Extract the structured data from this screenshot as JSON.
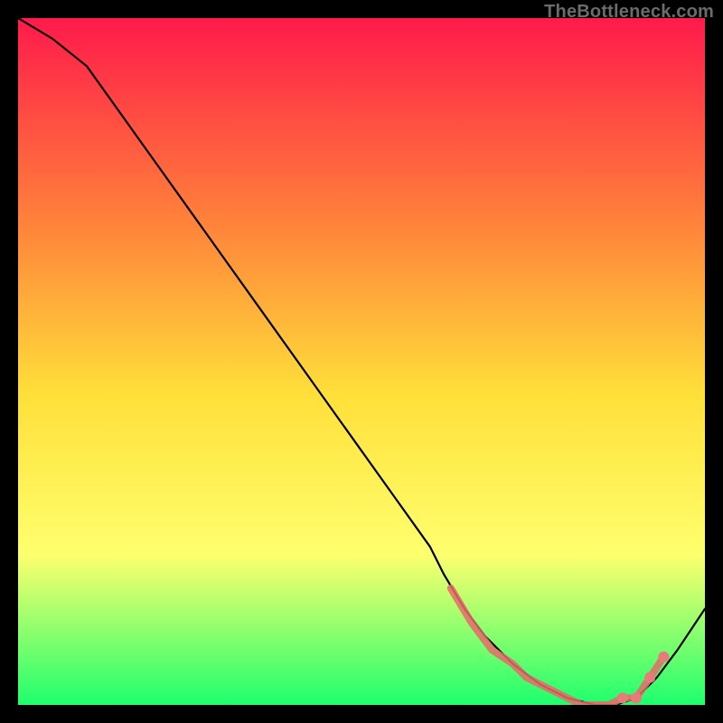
{
  "watermark": "TheBottleneck.com",
  "colors": {
    "gradient_top": "#ff1a4b",
    "gradient_mid1": "#ff833a",
    "gradient_mid2": "#ffe03a",
    "gradient_mid3": "#ffff6e",
    "gradient_bottom": "#1eff6e",
    "line": "#000000",
    "marker": "#e86a6a",
    "marker_fill": "#e97a7a"
  },
  "chart_data": {
    "type": "line",
    "title": "",
    "xlabel": "",
    "ylabel": "",
    "xlim": [
      0,
      100
    ],
    "ylim": [
      0,
      100
    ],
    "series": [
      {
        "name": "curve",
        "x": [
          0,
          5,
          10,
          15,
          20,
          25,
          30,
          35,
          40,
          45,
          50,
          55,
          60,
          62,
          65,
          68,
          72,
          76,
          80,
          84,
          87,
          90,
          93,
          96,
          100
        ],
        "y": [
          100,
          97,
          93,
          86,
          79,
          72,
          65,
          58,
          51,
          44,
          37,
          30,
          23,
          19,
          14,
          10,
          6,
          3,
          1,
          0,
          0,
          1,
          4,
          8,
          14
        ]
      }
    ],
    "markers": {
      "name": "highlight-points",
      "x": [
        63,
        66,
        69,
        72,
        74,
        76,
        78,
        80,
        82,
        84,
        86,
        88,
        90,
        92,
        94
      ],
      "y": [
        17,
        12,
        8,
        6,
        4,
        3,
        2,
        1,
        0,
        0,
        0,
        1,
        1,
        4,
        7
      ]
    }
  }
}
